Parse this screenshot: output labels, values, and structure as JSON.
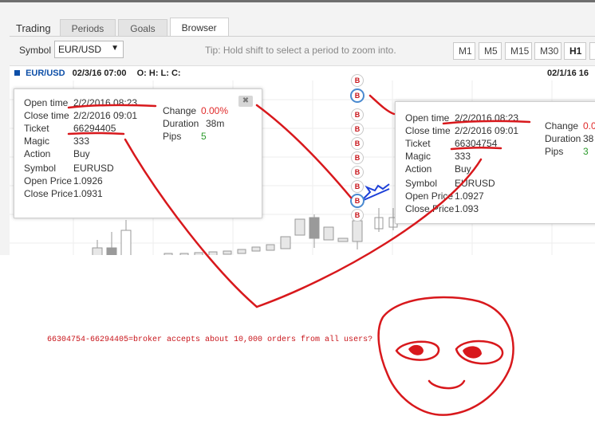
{
  "tabs": [
    "Trading",
    "Periods",
    "Goals",
    "Browser"
  ],
  "active_tab": "Browser",
  "toolbar": {
    "symbol_label": "Symbol",
    "symbol_value": "EUR/USD",
    "symbol_caret": "▼",
    "tip": "Tip: Hold shift to select a period to zoom into.",
    "timeframes": [
      "M1",
      "M5",
      "M15",
      "M30",
      "H1"
    ],
    "active_timeframe": "H1"
  },
  "chart_header": {
    "symbol": "EUR/USD",
    "datetime": "02/3/16 07:00",
    "ohlc": "O: H: L: C:",
    "right_date": "02/1/16 16"
  },
  "trade_markers": [
    "B",
    "B",
    "B",
    "B",
    "B",
    "B",
    "B",
    "B",
    "B",
    "B"
  ],
  "popup_left": {
    "labels": {
      "open_time": "Open time",
      "close_time": "Close time",
      "ticket": "Ticket",
      "magic": "Magic",
      "action": "Action",
      "symbol": "Symbol",
      "open_price": "Open Price",
      "close_price": "Close Price",
      "change": "Change",
      "duration": "Duration",
      "pips": "Pips"
    },
    "open_time": "2/2/2016 08:23",
    "close_time": "2/2/2016 09:01",
    "ticket": "66294405",
    "magic": "333",
    "action": "Buy",
    "symbol": "EURUSD",
    "open_price": "1.0926",
    "close_price": "1.0931",
    "change": "0.00%",
    "duration": "38m",
    "pips": "5",
    "close_icon": "✖"
  },
  "popup_right": {
    "labels": {
      "open_time": "Open time",
      "close_time": "Close time",
      "ticket": "Ticket",
      "magic": "Magic",
      "action": "Action",
      "symbol": "Symbol",
      "open_price": "Open Price",
      "close_price": "Close Price",
      "change": "Change",
      "duration": "Duration",
      "pips": "Pips"
    },
    "open_time": "2/2/2016 08:23",
    "close_time": "2/2/2016 09:01",
    "ticket": "66304754",
    "magic": "333",
    "action": "Buy",
    "symbol": "EURUSD",
    "open_price": "1.0927",
    "close_price": "1.093",
    "change": "0.0",
    "duration": "38",
    "pips": "3"
  },
  "annotation": {
    "note": "66304754-66294405=broker accepts about 10,000 orders from all users?"
  },
  "colors": {
    "scribble": "#d8181c",
    "accent_blue": "#0d4fa8",
    "change_red": "#e02a2a",
    "pips_green": "#2a9a2a"
  }
}
